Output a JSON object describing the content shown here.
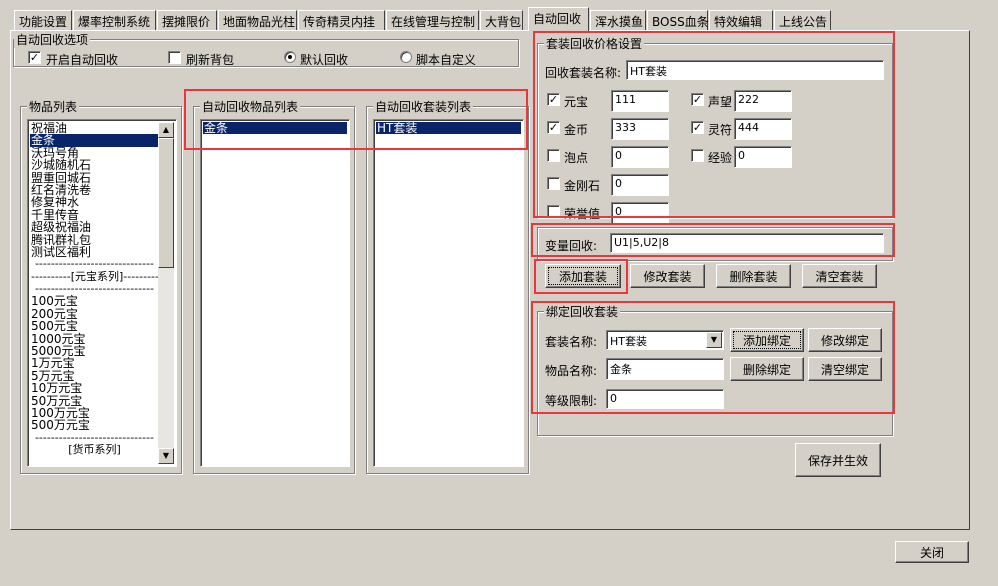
{
  "tabs": [
    "功能设置",
    "爆率控制系统",
    "摆摊限价",
    "地面物品光柱",
    "传奇精灵内挂",
    "在线管理与控制",
    "大背包",
    "自动回收",
    "浑水摸鱼",
    "BOSS血条",
    "特效编辑",
    "上线公告"
  ],
  "active_tab": "自动回收",
  "auto_options": {
    "title": "自动回收选项",
    "enable_label": "开启自动回收",
    "refresh_label": "刷新背包",
    "default_label": "默认回收",
    "script_label": "脚本自定义",
    "check_mark": "✓"
  },
  "item_list": {
    "title": "物品列表",
    "items": [
      "祝福油",
      "金条",
      "沃玛号角",
      "沙城随机石",
      "盟重回城石",
      "红名清洗卷",
      "修复神水",
      "千里传音",
      "超级祝福油",
      "腾讯群礼包",
      "测试区福利",
      "------------------------------",
      "----------[元宝系列]----------",
      "------------------------------",
      "100元宝",
      "200元宝",
      "500元宝",
      "1000元宝",
      "5000元宝",
      "1万元宝",
      "5万元宝",
      "10万元宝",
      "50万元宝",
      "100万元宝",
      "500万元宝",
      "------------------------------",
      "[货币系列]"
    ],
    "selected": "金条"
  },
  "auto_item_list": {
    "title": "自动回收物品列表",
    "items": [
      "金条"
    ]
  },
  "auto_set_list": {
    "title": "自动回收套装列表",
    "items": [
      "HT套装"
    ]
  },
  "price": {
    "title": "套装回收价格设置",
    "name_label": "回收套装名称:",
    "name_value": "HT套装",
    "fields": [
      {
        "label": "元宝",
        "value": "111",
        "checked": true
      },
      {
        "label": "金币",
        "value": "333",
        "checked": true
      },
      {
        "label": "泡点",
        "value": "0",
        "checked": false
      },
      {
        "label": "金刚石",
        "value": "0",
        "checked": false
      },
      {
        "label": "荣誉值",
        "value": "0",
        "checked": false
      },
      {
        "label": "声望",
        "value": "222",
        "checked": true
      },
      {
        "label": "灵符",
        "value": "444",
        "checked": true
      },
      {
        "label": "经验",
        "value": "0",
        "checked": false
      }
    ]
  },
  "var_recycle": {
    "label": "变量回收:",
    "value": "U1|5,U2|8"
  },
  "set_buttons": {
    "add": "添加套装",
    "modify": "修改套装",
    "delete": "删除套装",
    "clear": "清空套装"
  },
  "bind": {
    "title": "绑定回收套装",
    "set_name_label": "套装名称:",
    "set_name_value": "HT套装",
    "item_name_label": "物品名称:",
    "item_name_value": "金条",
    "level_label": "等级限制:",
    "level_value": "0",
    "add": "添加绑定",
    "modify": "修改绑定",
    "delete": "删除绑定",
    "clear": "清空绑定"
  },
  "save_button": "保存并生效",
  "close_button": "关闭",
  "colors": {
    "highlight_box": "#e8373d",
    "selection": "#0a246a",
    "face": "#d4d0c8"
  }
}
